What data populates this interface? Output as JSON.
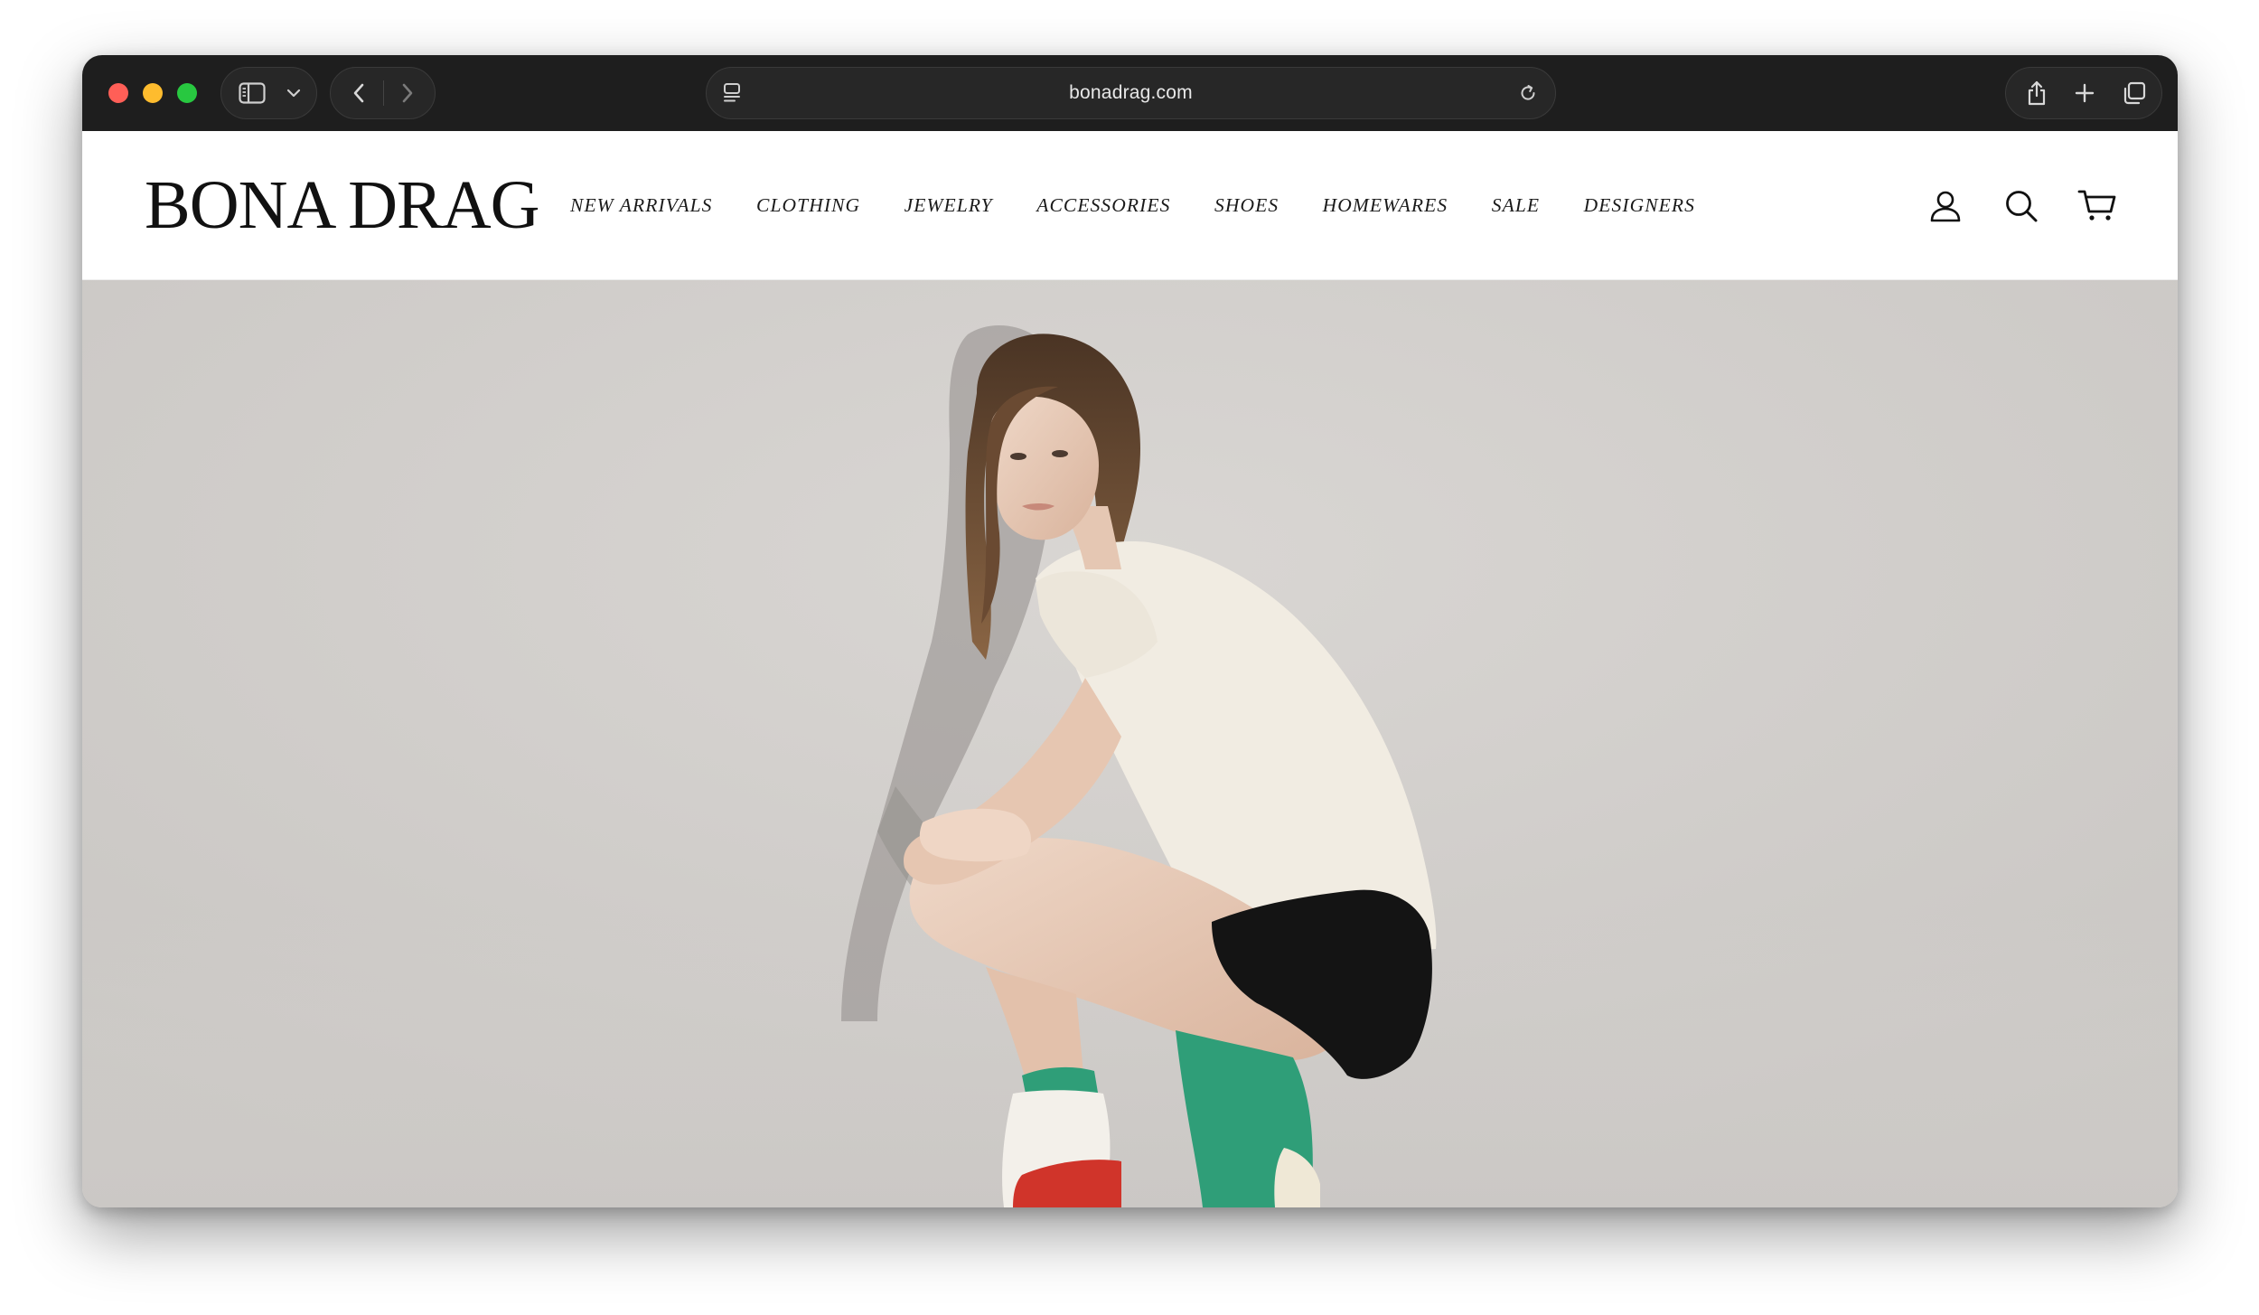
{
  "browser": {
    "url": "bonadrag.com"
  },
  "site": {
    "logo": "BONA DRAG",
    "nav": [
      {
        "label": "NEW ARRIVALS"
      },
      {
        "label": "CLOTHING"
      },
      {
        "label": "JEWELRY"
      },
      {
        "label": "ACCESSORIES"
      },
      {
        "label": "SHOES"
      },
      {
        "label": "HOMEWARES"
      },
      {
        "label": "SALE"
      },
      {
        "label": "DESIGNERS"
      }
    ],
    "icons": [
      "account-icon",
      "search-icon",
      "cart-icon"
    ]
  },
  "colors": {
    "chrome_bg": "#1e1e1e",
    "hero_bg": "#d4d1ce",
    "text": "#111111"
  }
}
